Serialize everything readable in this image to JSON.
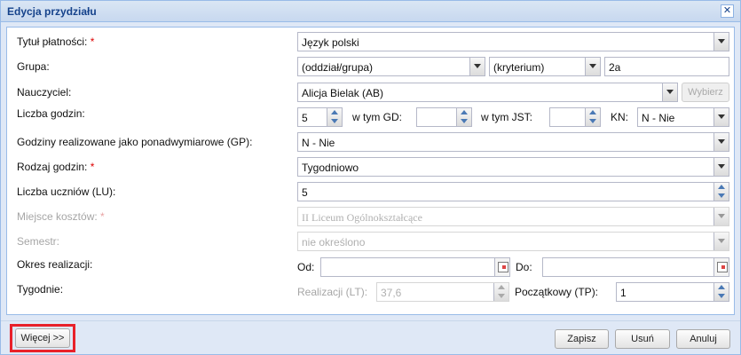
{
  "dialog": {
    "title": "Edycja przydziału",
    "close_glyph": "✕"
  },
  "labels": {
    "tytul": "Tytuł płatności:",
    "grupa": "Grupa:",
    "nauczyciel": "Nauczyciel:",
    "liczba_godzin": "Liczba godzin:",
    "w_tym_gd": "w tym GD:",
    "w_tym_jst": "w tym JST:",
    "kn": "KN:",
    "gp": "Godziny realizowane jako ponadwymiarowe (GP):",
    "rodzaj": "Rodzaj godzin:",
    "liczba_uczniow": "Liczba uczniów (LU):",
    "miejsce": "Miejsce kosztów:",
    "semestr": "Semestr:",
    "okres": "Okres realizacji:",
    "od": "Od:",
    "do": "Do:",
    "tygodnie": "Tygodnie:",
    "realizacji": "Realizacji (LT):",
    "poczatkowy": "Początkowy (TP):",
    "required_mark": "*"
  },
  "fields": {
    "tytul": "Język polski",
    "grupa_typ": "(oddział/grupa)",
    "kryterium": "(kryterium)",
    "grupa_nazwa": "2a",
    "nauczyciel": "Alicja Bielak (AB)",
    "liczba_godzin": "5",
    "w_tym_gd": "",
    "w_tym_jst": "",
    "kn": "N - Nie",
    "gp": "N - Nie",
    "rodzaj": "Tygodniowo",
    "liczba_uczniow": "5",
    "miejsce": "II Liceum Ogólnokształcące",
    "semestr": "nie określono",
    "od": "",
    "do": "",
    "realizacji": "37,6",
    "poczatkowy": "1"
  },
  "buttons": {
    "wybierz": "Wybierz",
    "wiecej": "Więcej >>",
    "zapisz": "Zapisz",
    "usun": "Usuń",
    "anuluj": "Anuluj"
  }
}
